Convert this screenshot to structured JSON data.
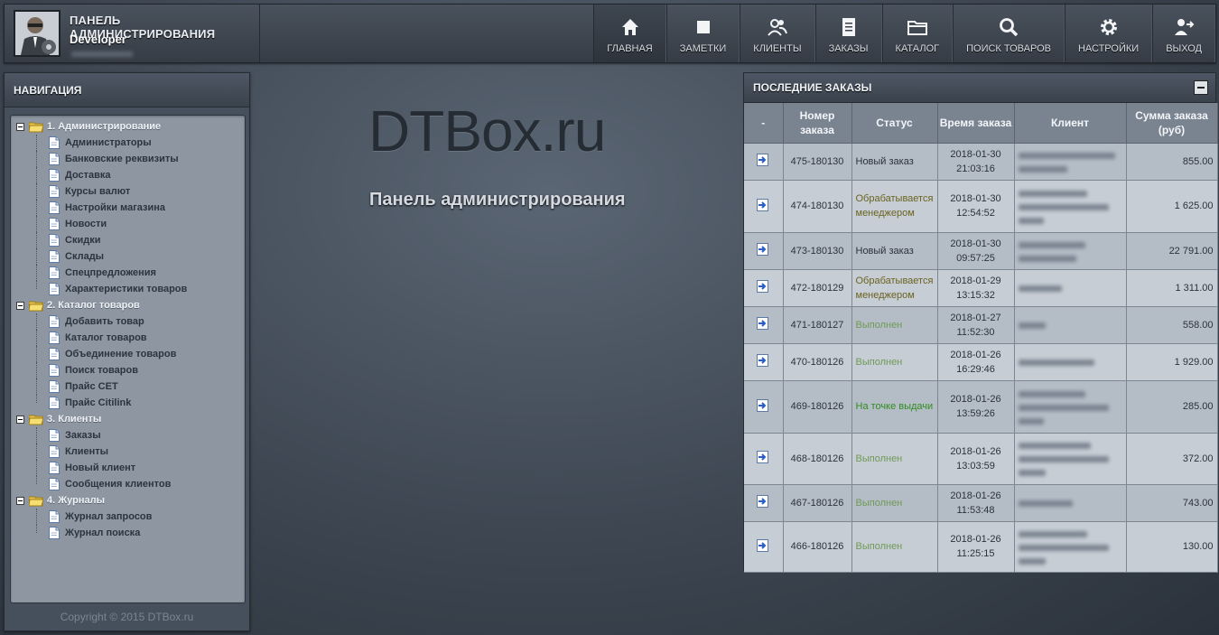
{
  "header": {
    "title": "ПАНЕЛЬ АДМИНИСТРИРОВАНИЯ",
    "user": "Developer"
  },
  "nav": [
    {
      "label": "ГЛАВНАЯ",
      "icon": "home-icon"
    },
    {
      "label": "ЗАМЕТКИ",
      "icon": "note-icon"
    },
    {
      "label": "КЛИЕНТЫ",
      "icon": "users-icon"
    },
    {
      "label": "ЗАКАЗЫ",
      "icon": "document-icon"
    },
    {
      "label": "КАТАЛОГ",
      "icon": "folder-icon"
    },
    {
      "label": "ПОИСК ТОВАРОВ",
      "icon": "search-icon"
    },
    {
      "label": "НАСТРОЙКИ",
      "icon": "gear-icon"
    },
    {
      "label": "ВЫХОД",
      "icon": "logout-icon"
    }
  ],
  "sidebar": {
    "title": "НАВИГАЦИЯ",
    "groups": [
      {
        "label": "1. Администрирование",
        "items": [
          "Администраторы",
          "Банковские реквизиты",
          "Доставка",
          "Курсы валют",
          "Настройки магазина",
          "Новости",
          "Скидки",
          "Склады",
          "Спецпредложения",
          "Характеристики товаров"
        ]
      },
      {
        "label": "2. Каталог товаров",
        "items": [
          "Добавить товар",
          "Каталог товаров",
          "Объединение товаров",
          "Поиск товаров",
          "Прайс CET",
          "Прайс Citilink"
        ]
      },
      {
        "label": "3. Клиенты",
        "items": [
          "Заказы",
          "Клиенты",
          "Новый клиент",
          "Сообщения клиентов"
        ]
      },
      {
        "label": "4. Журналы",
        "items": [
          "Журнал запросов",
          "Журнал поиска"
        ]
      }
    ],
    "copyright": "Copyright © 2015 DTBox.ru"
  },
  "main": {
    "title": "DTBox.ru",
    "subtitle": "Панель администрирования"
  },
  "orders": {
    "title": "ПОСЛЕДНИЕ ЗАКАЗЫ",
    "columns": [
      "-",
      "Номер заказа",
      "Статус",
      "Время заказа",
      "Клиент",
      "Сумма заказа (руб)"
    ],
    "rows": [
      {
        "number": "475-180130",
        "status": "Новый заказ",
        "status_type": "new",
        "date": "2018-01-30",
        "time": "21:03:16",
        "sum": "855.00"
      },
      {
        "number": "474-180130",
        "status": "Обрабатывается менеджером",
        "status_type": "proc",
        "date": "2018-01-30",
        "time": "12:54:52",
        "sum": "1 625.00"
      },
      {
        "number": "473-180130",
        "status": "Новый заказ",
        "status_type": "new",
        "date": "2018-01-30",
        "time": "09:57:25",
        "sum": "22 791.00"
      },
      {
        "number": "472-180129",
        "status": "Обрабатывается менеджером",
        "status_type": "proc",
        "date": "2018-01-29",
        "time": "13:15:32",
        "sum": "1 311.00"
      },
      {
        "number": "471-180127",
        "status": "Выполнен",
        "status_type": "done",
        "date": "2018-01-27",
        "time": "11:52:30",
        "sum": "558.00"
      },
      {
        "number": "470-180126",
        "status": "Выполнен",
        "status_type": "done",
        "date": "2018-01-26",
        "time": "16:29:46",
        "sum": "1 929.00"
      },
      {
        "number": "469-180126",
        "status": "На точке выдачи",
        "status_type": "pickup",
        "date": "2018-01-26",
        "time": "13:59:26",
        "sum": "285.00"
      },
      {
        "number": "468-180126",
        "status": "Выполнен",
        "status_type": "done",
        "date": "2018-01-26",
        "time": "13:03:59",
        "sum": "372.00"
      },
      {
        "number": "467-180126",
        "status": "Выполнен",
        "status_type": "done",
        "date": "2018-01-26",
        "time": "11:53:48",
        "sum": "743.00"
      },
      {
        "number": "466-180126",
        "status": "Выполнен",
        "status_type": "done",
        "date": "2018-01-26",
        "time": "11:25:15",
        "sum": "130.00"
      }
    ]
  }
}
